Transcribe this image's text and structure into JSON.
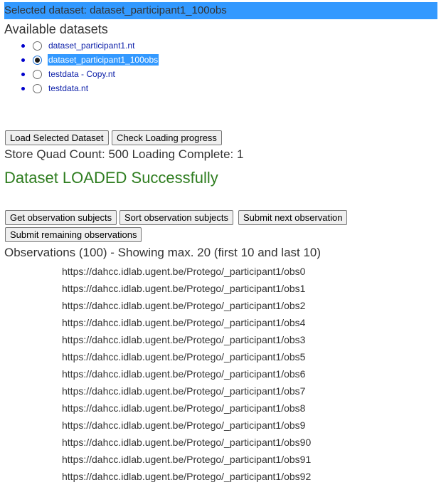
{
  "selected_bar": "Selected dataset: dataset_participant1_100obs",
  "datasets": {
    "heading": "Available datasets",
    "items": [
      {
        "label": "dataset_participant1.nt",
        "checked": false
      },
      {
        "label": "dataset_participant1_100obs",
        "checked": true
      },
      {
        "label": "testdata - Copy.nt",
        "checked": false
      },
      {
        "label": "testdata.nt",
        "checked": false
      }
    ]
  },
  "buttons": {
    "load_selected": "Load Selected Dataset",
    "check_progress": "Check Loading progress",
    "get_subjects": "Get observation subjects",
    "sort_subjects": "Sort observation subjects",
    "submit_next": "Submit next observation",
    "submit_remaining": "Submit remaining observations"
  },
  "status": {
    "store_line": "Store Quad Count: 500 Loading Complete: 1",
    "success_message": "Dataset LOADED Successfully"
  },
  "observations": {
    "heading": "Observations (100) - Showing max. 20 (first 10 and last 10)",
    "items": [
      "https://dahcc.idlab.ugent.be/Protego/_participant1/obs0",
      "https://dahcc.idlab.ugent.be/Protego/_participant1/obs1",
      "https://dahcc.idlab.ugent.be/Protego/_participant1/obs2",
      "https://dahcc.idlab.ugent.be/Protego/_participant1/obs4",
      "https://dahcc.idlab.ugent.be/Protego/_participant1/obs3",
      "https://dahcc.idlab.ugent.be/Protego/_participant1/obs5",
      "https://dahcc.idlab.ugent.be/Protego/_participant1/obs6",
      "https://dahcc.idlab.ugent.be/Protego/_participant1/obs7",
      "https://dahcc.idlab.ugent.be/Protego/_participant1/obs8",
      "https://dahcc.idlab.ugent.be/Protego/_participant1/obs9",
      "https://dahcc.idlab.ugent.be/Protego/_participant1/obs90",
      "https://dahcc.idlab.ugent.be/Protego/_participant1/obs91",
      "https://dahcc.idlab.ugent.be/Protego/_participant1/obs92"
    ]
  }
}
